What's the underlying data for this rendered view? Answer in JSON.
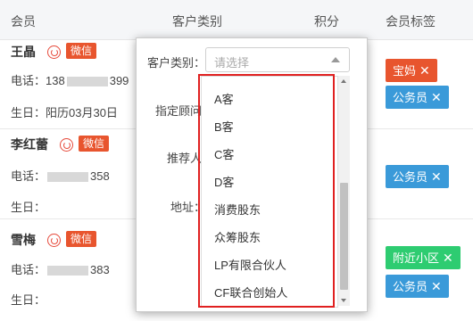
{
  "header": {
    "member": "会员",
    "customer_type": "客户类别",
    "points": "积分",
    "member_tags": "会员标签"
  },
  "members": [
    {
      "name": "王晶",
      "wechat": "微信",
      "phone_label": "电话：",
      "phone_prefix": "138",
      "phone_suffix": "399",
      "birthday_label": "生日：",
      "birthday": "阳历03月30日",
      "tags": [
        "宝妈",
        "公务员"
      ]
    },
    {
      "name": "李红蕾",
      "wechat": "微信",
      "phone_label": "电话：",
      "phone_prefix": "",
      "phone_suffix": "358",
      "birthday_label": "生日：",
      "birthday": "",
      "tags": [
        "公务员"
      ]
    },
    {
      "name": "雪梅",
      "wechat": "微信",
      "phone_label": "电话：",
      "phone_prefix": "",
      "phone_suffix": "383",
      "birthday_label": "生日：",
      "birthday": "",
      "tags": [
        "附近小区",
        "公务员"
      ]
    }
  ],
  "tag_remove_icon": "✕",
  "popup": {
    "customer_type_label": "客户类别：",
    "select_placeholder": "请选择",
    "advisor_label": "指定顾问",
    "referrer_label": "推荐人",
    "address_label": "地址："
  },
  "dropdown_options": [
    "A客",
    "B客",
    "C客",
    "D客",
    "消费股东",
    "众筹股东",
    "LP有限合伙人",
    "CF联合创始人"
  ],
  "colors": {
    "wechat_badge": "#e8552e",
    "tag_orange": "#e8552e",
    "tag_blue": "#3a9ad9",
    "tag_green": "#2ecc71",
    "highlight": "#e02020"
  }
}
